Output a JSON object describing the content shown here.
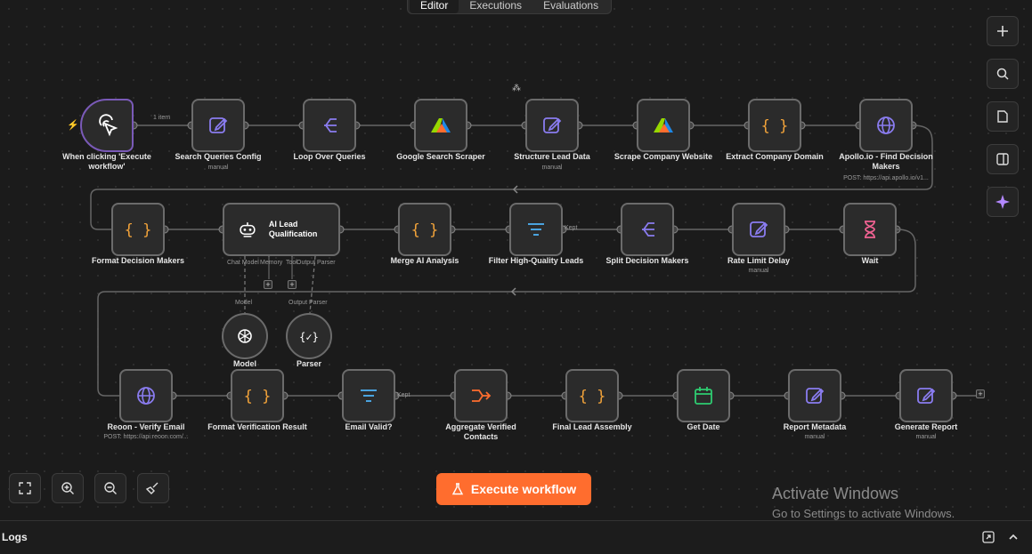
{
  "tabs": [
    "Editor",
    "Executions",
    "Evaluations"
  ],
  "row1": [
    {
      "title": "When clicking 'Execute workflow'",
      "sub": "",
      "icon": "pointer-click-icon"
    },
    {
      "title": "Search Queries Config",
      "sub": "manual",
      "icon": "edit-icon"
    },
    {
      "title": "Loop Over Queries",
      "sub": "",
      "icon": "split-icon"
    },
    {
      "title": "Google Search Scraper",
      "sub": "",
      "icon": "apify-icon"
    },
    {
      "title": "Structure Lead Data",
      "sub": "manual",
      "icon": "edit-icon"
    },
    {
      "title": "Scrape Company Website",
      "sub": "",
      "icon": "apify-icon"
    },
    {
      "title": "Extract Company Domain",
      "sub": "",
      "icon": "code-braces-icon"
    },
    {
      "title": "Apollo.io - Find Decision Makers",
      "sub": "POST: https://api.apollo.io/v1...",
      "icon": "globe-icon"
    }
  ],
  "row2": [
    {
      "title": "Format Decision Makers",
      "sub": "",
      "icon": "code-braces-icon"
    },
    {
      "title": "AI Lead Qualification",
      "sub": "",
      "icon": "robot-icon"
    },
    {
      "title": "Merge AI Analysis",
      "sub": "",
      "icon": "code-braces-icon"
    },
    {
      "title": "Filter High-Quality Leads",
      "sub": "",
      "icon": "filter-icon"
    },
    {
      "title": "Split Decision Makers",
      "sub": "",
      "icon": "split-icon"
    },
    {
      "title": "Rate Limit Delay",
      "sub": "manual",
      "icon": "edit-icon"
    },
    {
      "title": "Wait",
      "sub": "",
      "icon": "hourglass-icon"
    }
  ],
  "row3": [
    {
      "title": "Reoon - Verify Email",
      "sub": "POST: https://api.reoon.com/...",
      "icon": "globe-icon"
    },
    {
      "title": "Format Verification Result",
      "sub": "",
      "icon": "code-braces-icon"
    },
    {
      "title": "Email Valid?",
      "sub": "",
      "icon": "filter-icon"
    },
    {
      "title": "Aggregate Verified Contacts",
      "sub": "",
      "icon": "aggregate-icon"
    },
    {
      "title": "Final Lead Assembly",
      "sub": "",
      "icon": "code-braces-icon"
    },
    {
      "title": "Get Date",
      "sub": "",
      "icon": "calendar-icon"
    },
    {
      "title": "Report Metadata",
      "sub": "manual",
      "icon": "edit-icon"
    },
    {
      "title": "Generate Report",
      "sub": "manual",
      "icon": "edit-icon"
    }
  ],
  "sub_nodes": [
    {
      "title": "Model",
      "port": "Model",
      "icon": "openai-icon"
    },
    {
      "title": "Parser",
      "port": "Output Parser",
      "icon": "parser-icon"
    }
  ],
  "agent_ports": {
    "chat_model": "Chat Model",
    "memory": "Memory",
    "tool": "Tool",
    "output_parser": "Output Parser"
  },
  "edge_labels": {
    "items": "1 item",
    "kept1": "Kept",
    "kept2": "Kept"
  },
  "execute_label": "Execute workflow",
  "logs_label": "Logs",
  "activate": {
    "line1": "Activate Windows",
    "line2": "Go to Settings to activate Windows."
  }
}
